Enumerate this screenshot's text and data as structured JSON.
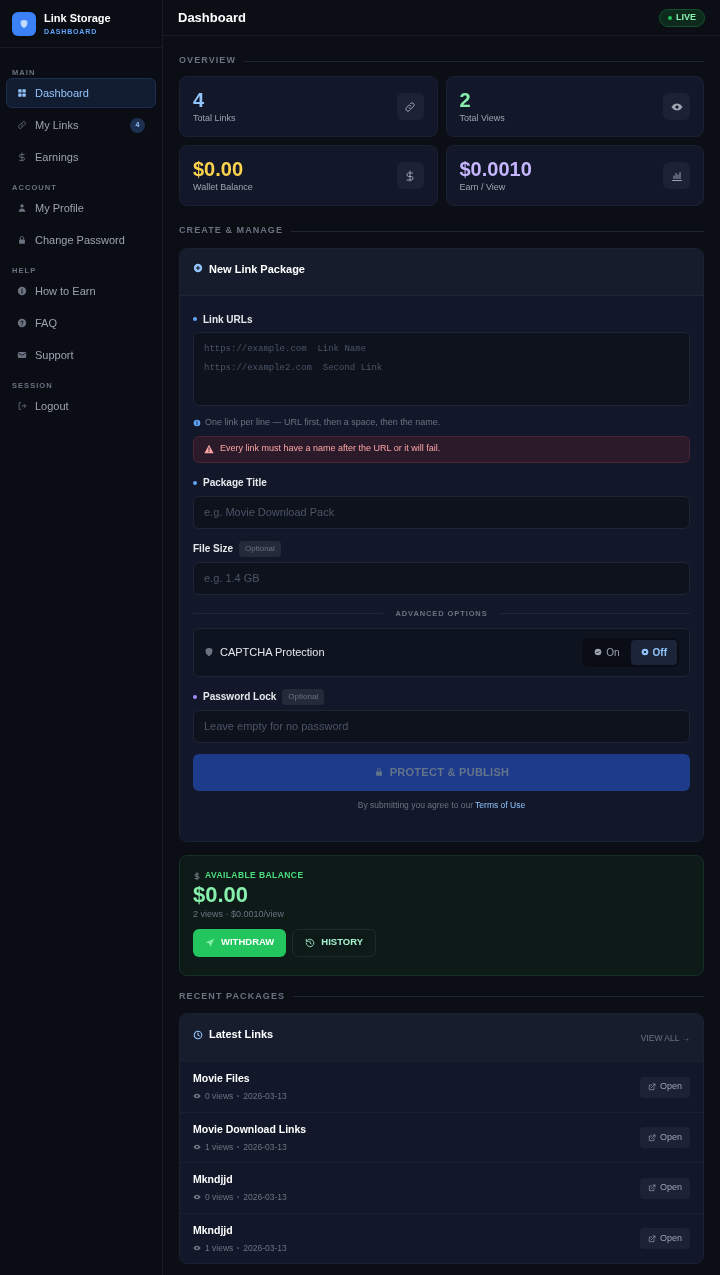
{
  "brand": {
    "name": "Link Storage",
    "subtitle": "DASHBOARD"
  },
  "sidebar": {
    "sections": [
      {
        "label": "MAIN",
        "items": [
          {
            "label": "Dashboard",
            "kind": "grid",
            "selected": true
          },
          {
            "label": "My Links",
            "kind": "link",
            "selected": false,
            "badge": "4"
          },
          {
            "label": "Earnings",
            "kind": "dollar",
            "selected": false
          }
        ]
      },
      {
        "label": "ACCOUNT",
        "items": [
          {
            "label": "My Profile",
            "kind": "user",
            "selected": false
          },
          {
            "label": "Change Password",
            "kind": "lock",
            "selected": false
          }
        ]
      },
      {
        "label": "HELP",
        "items": [
          {
            "label": "How to Earn",
            "kind": "info",
            "selected": false
          },
          {
            "label": "FAQ",
            "kind": "question",
            "selected": false
          },
          {
            "label": "Support",
            "kind": "mail",
            "selected": false
          }
        ]
      },
      {
        "label": "SESSION",
        "items": [
          {
            "label": "Logout",
            "kind": "logout",
            "selected": false
          }
        ]
      }
    ]
  },
  "header": {
    "title": "Dashboard",
    "status": "LIVE"
  },
  "overview": {
    "label": "OVERVIEW",
    "stats": [
      {
        "value": "4",
        "label": "Total Links",
        "kind": "link",
        "color": "#93c5fd"
      },
      {
        "value": "2",
        "label": "Total Views",
        "kind": "eye",
        "color": "#86efac"
      },
      {
        "value": "$0.00",
        "label": "Wallet Balance",
        "kind": "dollar",
        "color": "#fcd34d"
      },
      {
        "value": "$0.0010",
        "label": "Earn / View",
        "kind": "chart",
        "color": "#c4b5fd"
      }
    ]
  },
  "create": {
    "label": "CREATE & MANAGE",
    "title": "New Link Package",
    "urls": {
      "label": "Link URLs",
      "placeholder_lines": [
        "https://example.com  Link Name",
        "https://example2.com  Second Link"
      ]
    },
    "hint": "One link per line — URL first, then a space, then the name.",
    "warning": "Every link must have a name after the URL or it will fail.",
    "package_title": {
      "label": "Package Title",
      "placeholder": "e.g. Movie Download Pack"
    },
    "file_size": {
      "label": "File Size",
      "tag": "Optional",
      "placeholder": "e.g. 1.4 GB"
    },
    "advanced_label": "ADVANCED OPTIONS",
    "captcha": {
      "label": "CAPTCHA Protection",
      "options": [
        {
          "label": "On",
          "kind": "check",
          "selected": false
        },
        {
          "label": "Off",
          "kind": "x",
          "selected": true
        }
      ]
    },
    "password": {
      "label": "Password Lock",
      "tag": "Optional",
      "placeholder": "Leave empty for no password"
    },
    "submit": {
      "label": "PROTECT & PUBLISH",
      "disabled": true
    },
    "terms": {
      "text": "By submitting you agree to our",
      "link": "Terms of Use"
    }
  },
  "balance": {
    "label": "AVAILABLE BALANCE",
    "amount": "$0.00",
    "detail": "2 views · $0.0010/view",
    "withdraw": "WITHDRAW",
    "history": "HISTORY"
  },
  "recent": {
    "label": "RECENT PACKAGES",
    "title": "Latest Links",
    "view_all": "VIEW ALL →",
    "rows": [
      {
        "name": "Movie Files",
        "views": "0 views",
        "date": "2026-03-13",
        "action": "Open"
      },
      {
        "name": "Movie Download Links",
        "views": "1 views",
        "date": "2026-03-13",
        "action": "Open"
      },
      {
        "name": "Mkndjjd",
        "views": "0 views",
        "date": "2026-03-13",
        "action": "Open"
      },
      {
        "name": "Mkndjjd",
        "views": "1 views",
        "date": "2026-03-13",
        "action": "Open"
      }
    ]
  }
}
